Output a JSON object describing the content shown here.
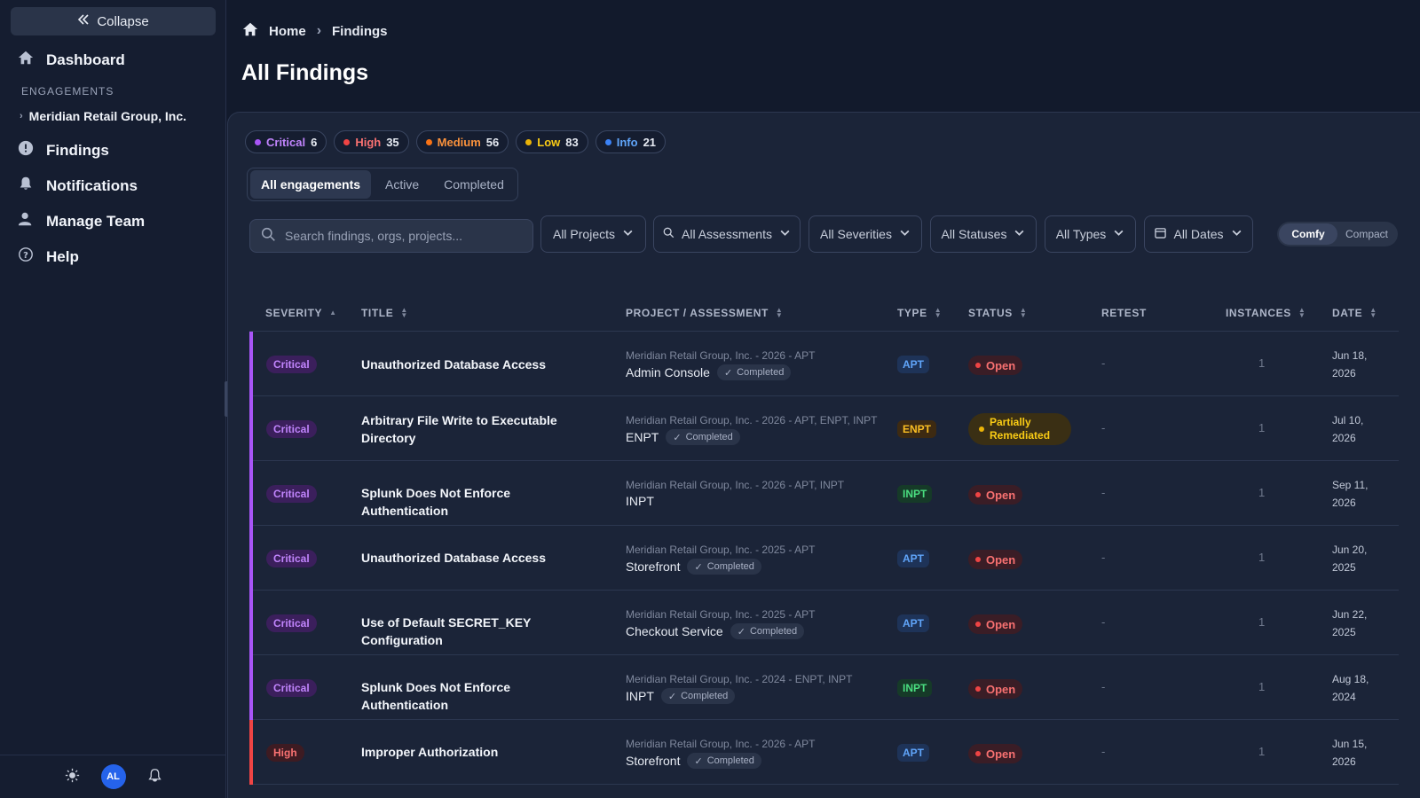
{
  "sidebar": {
    "collapse_label": "Collapse",
    "nav_dashboard": "Dashboard",
    "section_label": "ENGAGEMENTS",
    "engagement": "Meridian Retail Group, Inc.",
    "nav_findings": "Findings",
    "nav_notifications": "Notifications",
    "nav_team": "Manage Team",
    "nav_help": "Help",
    "avatar_initials": "AL"
  },
  "breadcrumb": {
    "home": "Home",
    "current": "Findings"
  },
  "page_title": "All Findings",
  "severity_chips": [
    {
      "label": "Critical",
      "count": "6",
      "color": "#a855f7"
    },
    {
      "label": "High",
      "count": "35",
      "color": "#ef4444"
    },
    {
      "label": "Medium",
      "count": "56",
      "color": "#f97316"
    },
    {
      "label": "Low",
      "count": "83",
      "color": "#eab308"
    },
    {
      "label": "Info",
      "count": "21",
      "color": "#3b82f6"
    }
  ],
  "engagement_tabs": {
    "all": "All engagements",
    "active": "Active",
    "completed": "Completed"
  },
  "search": {
    "placeholder": "Search findings, orgs, projects..."
  },
  "filters": {
    "projects": "All Projects",
    "assessments": "All Assessments",
    "severities": "All Severities",
    "statuses": "All Statuses",
    "types": "All Types",
    "dates": "All Dates"
  },
  "density": {
    "comfy": "Comfy",
    "compact": "Compact"
  },
  "table": {
    "headers": {
      "severity": "SEVERITY",
      "title": "TITLE",
      "project": "PROJECT / ASSESSMENT",
      "type": "TYPE",
      "status": "STATUS",
      "retest": "RETEST",
      "instances": "INSTANCES",
      "date": "DATE"
    },
    "rows": [
      {
        "severity": "Critical",
        "title": "Unauthorized Database Access",
        "org": "Meridian Retail Group, Inc. - 2026 - APT",
        "assessment": "Admin Console",
        "completed": "Completed",
        "type": "APT",
        "status": "Open",
        "retest": "-",
        "instances": "1",
        "date": "Jun 18, 2026"
      },
      {
        "severity": "Critical",
        "title": "Arbitrary File Write to Executable Directory",
        "org": "Meridian Retail Group, Inc. - 2026 - APT, ENPT, INPT",
        "assessment": "ENPT",
        "completed": "Completed",
        "type": "ENPT",
        "status": "Partially Remediated",
        "retest": "-",
        "instances": "1",
        "date": "Jul 10, 2026"
      },
      {
        "severity": "Critical",
        "title": "Splunk Does Not Enforce Authentication",
        "org": "Meridian Retail Group, Inc. - 2026 - APT, INPT",
        "assessment": "INPT",
        "completed": "",
        "type": "INPT",
        "status": "Open",
        "retest": "-",
        "instances": "1",
        "date": "Sep 11, 2026"
      },
      {
        "severity": "Critical",
        "title": "Unauthorized Database Access",
        "org": "Meridian Retail Group, Inc. - 2025 - APT",
        "assessment": "Storefront",
        "completed": "Completed",
        "type": "APT",
        "status": "Open",
        "retest": "-",
        "instances": "1",
        "date": "Jun 20, 2025"
      },
      {
        "severity": "Critical",
        "title": "Use of Default SECRET_KEY Configuration",
        "org": "Meridian Retail Group, Inc. - 2025 - APT",
        "assessment": "Checkout Service",
        "completed": "Completed",
        "type": "APT",
        "status": "Open",
        "retest": "-",
        "instances": "1",
        "date": "Jun 22, 2025"
      },
      {
        "severity": "Critical",
        "title": "Splunk Does Not Enforce Authentication",
        "org": "Meridian Retail Group, Inc. - 2024 - ENPT, INPT",
        "assessment": "INPT",
        "completed": "Completed",
        "type": "INPT",
        "status": "Open",
        "retest": "-",
        "instances": "1",
        "date": "Aug 18, 2024"
      },
      {
        "severity": "High",
        "title": "Improper Authorization",
        "org": "Meridian Retail Group, Inc. - 2026 - APT",
        "assessment": "Storefront",
        "completed": "Completed",
        "type": "APT",
        "status": "Open",
        "retest": "-",
        "instances": "1",
        "date": "Jun 15, 2026"
      }
    ]
  },
  "colors": {
    "critical": "#a855f7",
    "high": "#ef4444",
    "open": "#ef4444",
    "partial": "#eab308",
    "type_apt": "#60a5fa",
    "type_enpt": "#f59e0b",
    "type_inpt": "#4ade80"
  }
}
